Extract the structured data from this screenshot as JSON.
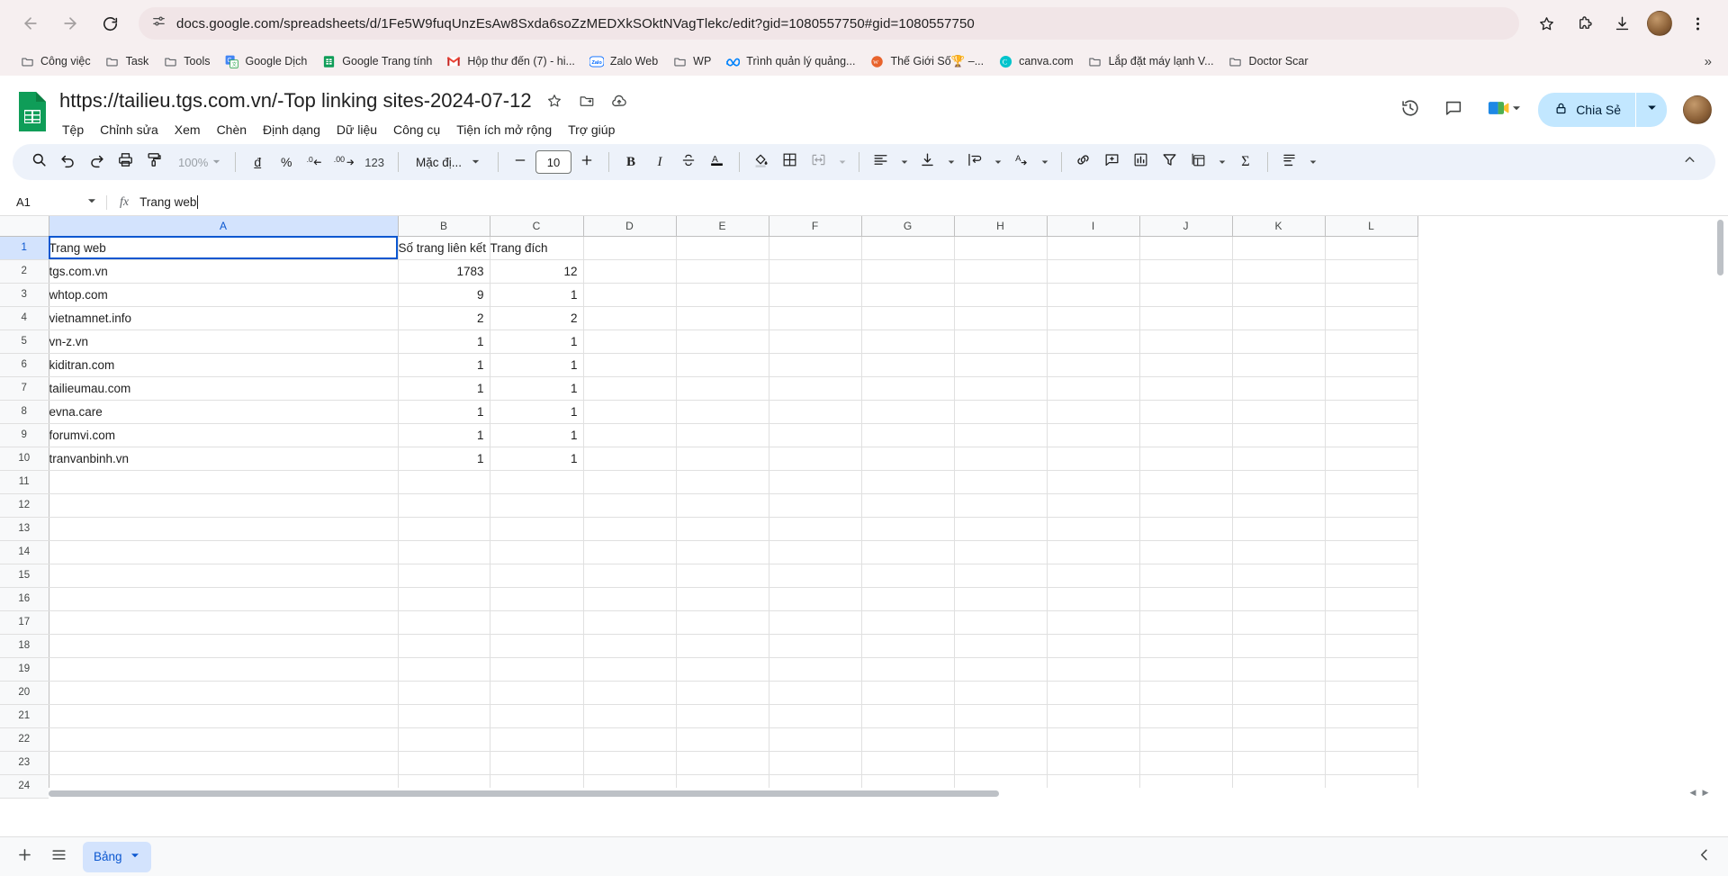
{
  "browser": {
    "url": "docs.google.com/spreadsheets/d/1Fe5W9fuqUnzEsAw8Sxda6soZzMEDXkSOktNVagTlekc/edit?gid=1080557750#gid=1080557750",
    "back_icon": "back-arrow-icon",
    "forward_icon": "forward-arrow-icon",
    "reload_icon": "reload-icon",
    "site_settings_icon": "site-settings-icon",
    "bookmark_star_icon": "bookmark-star-icon",
    "extensions_icon": "extensions-icon",
    "download_icon": "download-icon",
    "menu_icon": "three-dot-menu-icon",
    "bookmarks": [
      {
        "label": "Công việc",
        "icon": "folder-icon"
      },
      {
        "label": "Task",
        "icon": "folder-icon"
      },
      {
        "label": "Tools",
        "icon": "folder-icon"
      },
      {
        "label": "Google Dịch",
        "icon": "google-translate-icon"
      },
      {
        "label": "Google Trang tính",
        "icon": "google-sheets-icon"
      },
      {
        "label": "Hộp thư đến (7) - hi...",
        "icon": "gmail-icon"
      },
      {
        "label": "Zalo Web",
        "icon": "zalo-icon"
      },
      {
        "label": "WP",
        "icon": "folder-icon"
      },
      {
        "label": "Trình quản lý quảng...",
        "icon": "meta-icon"
      },
      {
        "label": "Thế Giới Số🏆 –...",
        "icon": "wordpress-icon"
      },
      {
        "label": "canva.com",
        "icon": "canva-icon"
      },
      {
        "label": "Lắp đặt máy lạnh V...",
        "icon": "folder-icon"
      },
      {
        "label": "Doctor Scar",
        "icon": "folder-icon"
      }
    ],
    "bookmarks_overflow": "»"
  },
  "sheets": {
    "doc_title": "https://tailieu.tgs.com.vn/-Top linking sites-2024-07-12",
    "logo_icon": "google-sheets-logo-icon",
    "star_icon": "star-icon",
    "move_icon": "move-to-folder-icon",
    "cloud_icon": "cloud-saved-icon",
    "menus": [
      "Tệp",
      "Chỉnh sửa",
      "Xem",
      "Chèn",
      "Định dạng",
      "Dữ liệu",
      "Công cụ",
      "Tiện ích mở rộng",
      "Trợ giúp"
    ],
    "header_right": {
      "history_icon": "version-history-icon",
      "comment_icon": "comment-icon",
      "meet_icon": "google-meet-icon",
      "meet_caret_icon": "chevron-down-icon",
      "share_label": "Chia Sẻ",
      "share_lock_icon": "lock-icon",
      "share_caret_icon": "chevron-down-icon",
      "avatar": "user-avatar"
    },
    "toolbar": {
      "zoom_value": "100%",
      "font_name": "Mặc đị...",
      "font_size": "10",
      "items": [
        {
          "name": "search-icon",
          "glyph": "search"
        },
        {
          "name": "undo-icon",
          "glyph": "undo"
        },
        {
          "name": "redo-icon",
          "glyph": "redo"
        },
        {
          "name": "print-icon",
          "glyph": "print"
        },
        {
          "name": "paint-format-icon",
          "glyph": "paint"
        },
        {
          "name": "currency-dong-icon",
          "glyph": "đ"
        },
        {
          "name": "percent-format-icon",
          "glyph": "%"
        },
        {
          "name": "decrease-decimal-icon",
          "glyph": ".0"
        },
        {
          "name": "increase-decimal-icon",
          "glyph": ".00"
        },
        {
          "name": "more-formats-icon",
          "glyph": "123"
        },
        {
          "name": "bold-icon",
          "glyph": "B"
        },
        {
          "name": "italic-icon",
          "glyph": "I"
        },
        {
          "name": "strikethrough-icon",
          "glyph": "S"
        },
        {
          "name": "text-color-icon",
          "glyph": "A"
        },
        {
          "name": "fill-color-icon",
          "glyph": "fill"
        },
        {
          "name": "borders-icon",
          "glyph": "borders"
        },
        {
          "name": "merge-cells-icon",
          "glyph": "merge"
        },
        {
          "name": "horizontal-align-icon",
          "glyph": "halign"
        },
        {
          "name": "vertical-align-icon",
          "glyph": "valign"
        },
        {
          "name": "text-wrapping-icon",
          "glyph": "wrap"
        },
        {
          "name": "text-rotation-icon",
          "glyph": "rotate"
        },
        {
          "name": "insert-link-icon",
          "glyph": "link"
        },
        {
          "name": "insert-comment-icon",
          "glyph": "comment"
        },
        {
          "name": "insert-chart-icon",
          "glyph": "chart"
        },
        {
          "name": "create-filter-icon",
          "glyph": "filter"
        },
        {
          "name": "filter-views-icon",
          "glyph": "filterviews"
        },
        {
          "name": "functions-icon",
          "glyph": "sigma"
        },
        {
          "name": "formatting-menu-icon",
          "glyph": "fmtmenu"
        }
      ],
      "collapse_icon": "chevron-up-icon"
    },
    "formula_bar": {
      "name_box": "A1",
      "name_box_caret": "chevron-down-icon",
      "fx_label": "fx",
      "value": "Trang web"
    },
    "grid": {
      "columns": [
        "A",
        "B",
        "C",
        "D",
        "E",
        "F",
        "G",
        "H",
        "I",
        "J",
        "K",
        "L"
      ],
      "selected_column": "A",
      "selected_row": 1,
      "active_cell": "A1",
      "rows": [
        {
          "n": 1,
          "A": "Trang web",
          "B": "Số trang liên kết",
          "C": "Trang đích",
          "link": false
        },
        {
          "n": 2,
          "A": "tgs.com.vn",
          "B": "1783",
          "C": "12",
          "link": true
        },
        {
          "n": 3,
          "A": "whtop.com",
          "B": "9",
          "C": "1",
          "link": true
        },
        {
          "n": 4,
          "A": "vietnamnet.info",
          "B": "2",
          "C": "2",
          "link": true
        },
        {
          "n": 5,
          "A": "vn-z.vn",
          "B": "1",
          "C": "1",
          "link": true
        },
        {
          "n": 6,
          "A": "kiditran.com",
          "B": "1",
          "C": "1",
          "link": true
        },
        {
          "n": 7,
          "A": "tailieumau.com",
          "B": "1",
          "C": "1",
          "link": true
        },
        {
          "n": 8,
          "A": "evna.care",
          "B": "1",
          "C": "1",
          "link": false
        },
        {
          "n": 9,
          "A": "forumvi.com",
          "B": "1",
          "C": "1",
          "link": true
        },
        {
          "n": 10,
          "A": "tranvanbinh.vn",
          "B": "1",
          "C": "1",
          "link": true
        },
        {
          "n": 11,
          "A": "",
          "B": "",
          "C": "",
          "link": false
        },
        {
          "n": 12,
          "A": "",
          "B": "",
          "C": "",
          "link": false
        },
        {
          "n": 13,
          "A": "",
          "B": "",
          "C": "",
          "link": false
        },
        {
          "n": 14,
          "A": "",
          "B": "",
          "C": "",
          "link": false
        },
        {
          "n": 15,
          "A": "",
          "B": "",
          "C": "",
          "link": false
        },
        {
          "n": 16,
          "A": "",
          "B": "",
          "C": "",
          "link": false
        },
        {
          "n": 17,
          "A": "",
          "B": "",
          "C": "",
          "link": false
        },
        {
          "n": 18,
          "A": "",
          "B": "",
          "C": "",
          "link": false
        },
        {
          "n": 19,
          "A": "",
          "B": "",
          "C": "",
          "link": false
        },
        {
          "n": 20,
          "A": "",
          "B": "",
          "C": "",
          "link": false
        },
        {
          "n": 21,
          "A": "",
          "B": "",
          "C": "",
          "link": false
        },
        {
          "n": 22,
          "A": "",
          "B": "",
          "C": "",
          "link": false
        },
        {
          "n": 23,
          "A": "",
          "B": "",
          "C": "",
          "link": false
        },
        {
          "n": 24,
          "A": "",
          "B": "",
          "C": "",
          "link": false
        }
      ]
    },
    "bottom": {
      "add_sheet_icon": "plus-icon",
      "all_sheets_icon": "all-sheets-icon",
      "sheet_tab_label": "Bảng",
      "sheet_tab_caret": "chevron-down-icon",
      "explore_icon": "explore-icon"
    }
  },
  "colors": {
    "accent_blue": "#0b57d0",
    "sheets_green": "#188038",
    "link_blue": "#1155cc",
    "toolbar_bg": "#edf2fa",
    "chrome_bg": "#f6eff0",
    "share_bg": "#c2e7ff"
  }
}
